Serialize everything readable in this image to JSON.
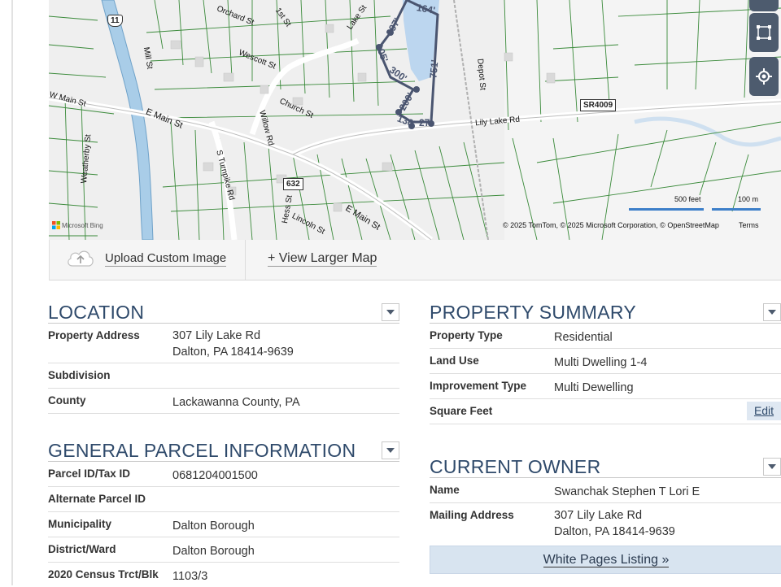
{
  "map": {
    "labels": {
      "orchard": "Orchard St",
      "first": "1st St",
      "lake": "Lake St",
      "mill": "Mill St",
      "wescott": "Wescott St",
      "church": "Church St",
      "willow": "Willow Rd",
      "wmain": "W Main St",
      "emain1": "E Main St",
      "emain2": "E Main St",
      "weatherby": "Weatherby St",
      "turnpike": "S Turnpike Rd",
      "hess": "Hess St",
      "lincoln": "Lincoln St",
      "depot": "Depot St",
      "lilylake": "Lily Lake Rd"
    },
    "shields": {
      "route11": "11",
      "route632": "632",
      "sr4009": "SR4009"
    },
    "measurements": [
      "164'",
      "397'",
      "105'",
      "300'",
      "751'",
      "200'",
      "136'",
      "27'"
    ],
    "scale": {
      "feet": "500 feet",
      "meters": "100 m"
    },
    "attribution": "© 2025 TomTom, © 2025 Microsoft Corporation, © OpenStreetMap",
    "terms": "Terms",
    "provider": "Microsoft Bing",
    "controls": [
      "layers-icon",
      "draw-polygon-icon",
      "locate-icon"
    ]
  },
  "toolbar": {
    "upload_label": "Upload Custom Image",
    "larger_label": "+ View Larger Map"
  },
  "location": {
    "title": "LOCATION",
    "rows": [
      {
        "label": "Property Address",
        "value": "307 Lily Lake Rd",
        "value2": "Dalton, PA 18414-9639"
      },
      {
        "label": "Subdivision",
        "value": ""
      },
      {
        "label": "County",
        "value": "Lackawanna County, PA"
      }
    ]
  },
  "parcel": {
    "title": "GENERAL PARCEL INFORMATION",
    "rows": [
      {
        "label": "Parcel ID/Tax ID",
        "value": "0681204001500"
      },
      {
        "label": "Alternate Parcel ID",
        "value": ""
      },
      {
        "label": "Municipality",
        "value": "Dalton Borough"
      },
      {
        "label": "District/Ward",
        "value": "Dalton Borough"
      },
      {
        "label": "2020 Census Trct/Blk",
        "value": "1103/3"
      }
    ]
  },
  "summary": {
    "title": "PROPERTY SUMMARY",
    "rows": [
      {
        "label": "Property Type",
        "value": "Residential"
      },
      {
        "label": "Land Use",
        "value": "Multi Dwelling 1-4"
      },
      {
        "label": "Improvement Type",
        "value": "Multi Dewelling"
      },
      {
        "label": "Square Feet",
        "value": ""
      }
    ],
    "edit_label": "Edit"
  },
  "owner": {
    "title": "CURRENT OWNER",
    "rows": [
      {
        "label": "Name",
        "value": "Swanchak Stephen T Lori E"
      },
      {
        "label": "Mailing Address",
        "value": "307 Lily Lake Rd",
        "value2": "Dalton, PA 18414-9639"
      }
    ],
    "white_pages": "White Pages Listing »"
  },
  "colors": {
    "heading": "#2f4a6b",
    "parcel_lines": "#3a8a3a",
    "water": "#a9cde8",
    "selected_outline": "#4a5570",
    "map_control": "#4d5b6e",
    "button_bg": "#d8e4f0"
  }
}
